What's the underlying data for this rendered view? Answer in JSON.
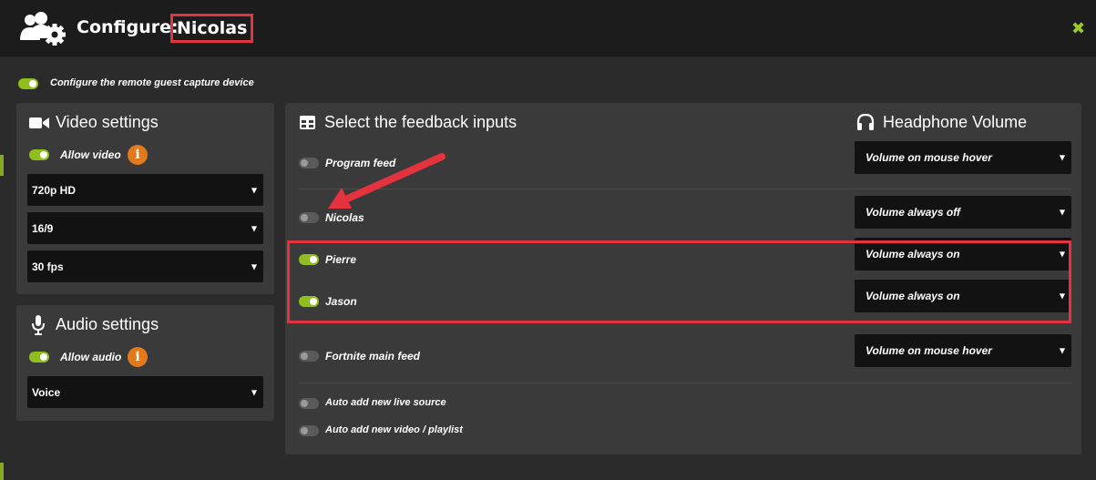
{
  "header": {
    "title_prefix": "Configure:",
    "title_name": "Nicolas",
    "icon": "users-gear-icon",
    "close_icon": "close-icon",
    "close_symbol": "✖"
  },
  "remote_capture": {
    "label": "Configure the remote guest capture device",
    "enabled": true
  },
  "video_settings": {
    "title": "Video settings",
    "icon": "video-camera-icon",
    "allow_label": "Allow video",
    "allow_enabled": true,
    "info_symbol": "i",
    "resolution": "720p HD",
    "aspect": "16/9",
    "fps": "30 fps"
  },
  "audio_settings": {
    "title": "Audio settings",
    "icon": "microphone-icon",
    "allow_label": "Allow audio",
    "allow_enabled": true,
    "info_symbol": "i",
    "mode": "Voice"
  },
  "feedback": {
    "title": "Select the feedback inputs",
    "icon": "grid-icon",
    "headphone_title": "Headphone Volume",
    "headphone_icon": "headphones-icon",
    "caret": "▼",
    "inputs": [
      {
        "label": "Program feed",
        "enabled": false,
        "volume": "Volume on mouse hover"
      },
      {
        "label": "Nicolas",
        "enabled": false,
        "volume": "Volume always off"
      },
      {
        "label": "Pierre",
        "enabled": true,
        "volume": "Volume always on"
      },
      {
        "label": "Jason",
        "enabled": true,
        "volume": "Volume always on"
      },
      {
        "label": "Fortnite main feed",
        "enabled": false,
        "volume": "Volume on mouse hover"
      }
    ],
    "auto_live": {
      "label": "Auto add new live source",
      "enabled": false
    },
    "auto_video": {
      "label": "Auto add new video / playlist",
      "enabled": false
    }
  },
  "colors": {
    "accent": "#8fbf1f",
    "highlight": "#e5323f",
    "info": "#e07a1c"
  }
}
